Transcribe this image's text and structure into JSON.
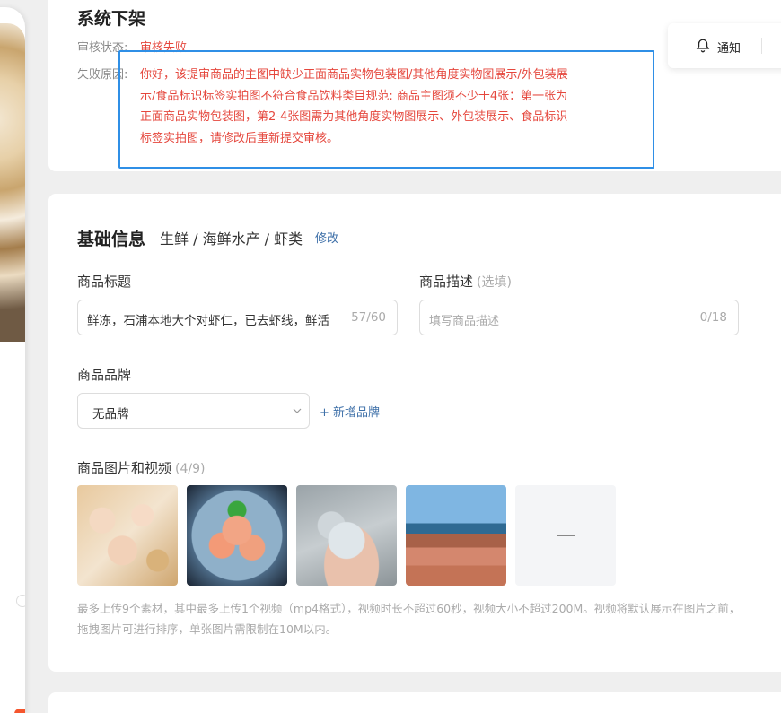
{
  "top_card": {
    "title": "系统下架",
    "status_label": "审核状态:",
    "status_value": "审核失败",
    "reason_label": "失败原因:",
    "reason_text": "你好，该提审商品的主图中缺少正面商品实物包装图/其他角度实物图展示/外包装展示/食品标识标签实拍图不符合食品饮料类目规范: 商品主图须不少于4张：第一张为正面商品实物包装图，第2-4张图需为其他角度实物图展示、外包装展示、食品标识标签实拍图，请修改后重新提交审核。"
  },
  "notify": {
    "label": "通知"
  },
  "basic_info": {
    "title": "基础信息",
    "category": "生鲜 / 海鲜水产 / 虾类",
    "modify": "修改",
    "product_title_label": "商品标题",
    "product_title_value": "鲜冻，石浦本地大个对虾仁，已去虾线，鲜活",
    "product_title_count": "57/60",
    "desc_label": "商品描述",
    "desc_optional": "(选填)",
    "desc_placeholder": "填写商品描述",
    "desc_count": "0/18",
    "brand_label": "商品品牌",
    "brand_value": "无品牌",
    "add_brand": "+ 新增品牌",
    "media_label": "商品图片和视频",
    "media_count": "(4/9)",
    "media_hint": "最多上传9个素材，其中最多上传1个视频（mp4格式），视频时长不超过60秒，视频大小不超过200M。视频将默认展示在图片之前，拖拽图片可进行排序，单张图片需限制在10M以内。"
  },
  "colors": {
    "error": "#e5473d",
    "link": "#3d6fa8",
    "highlight_border": "#2f8fe6"
  }
}
